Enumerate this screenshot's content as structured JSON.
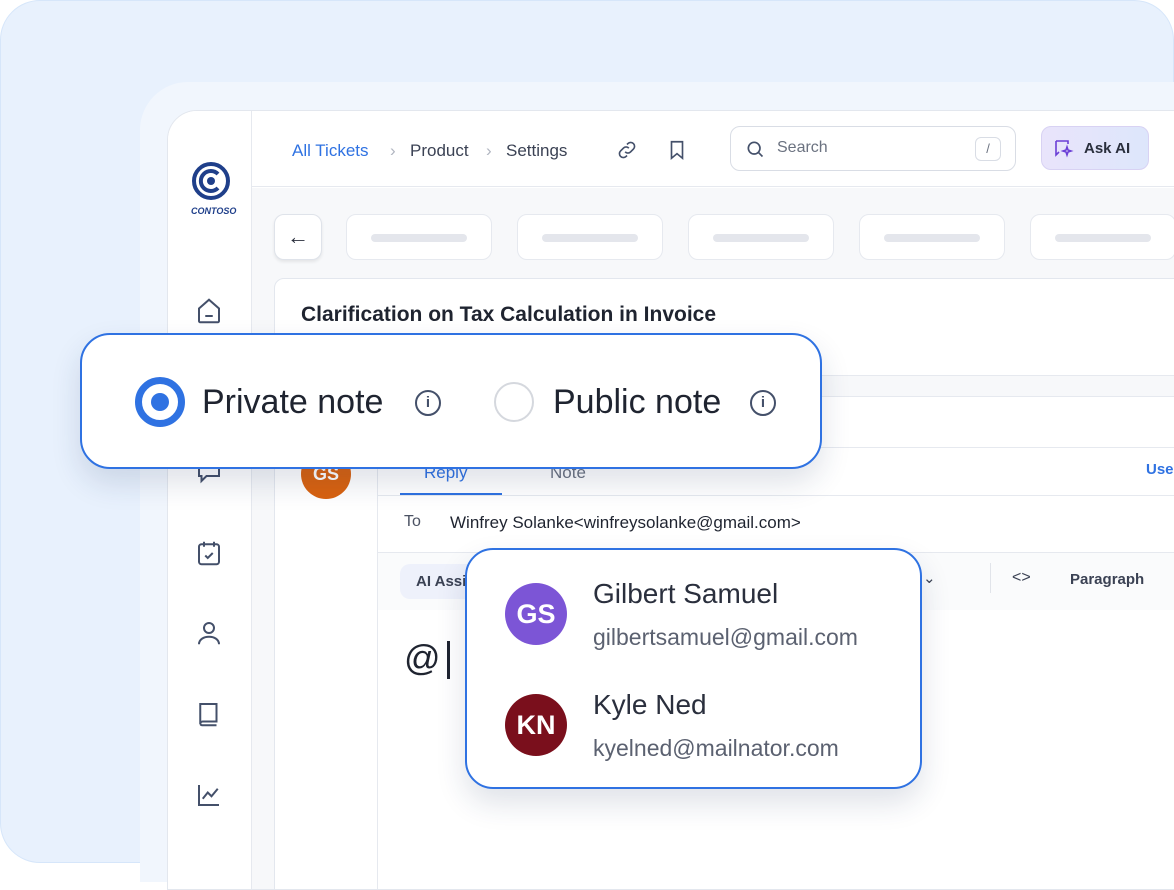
{
  "logo": {
    "text": "CONTOSO"
  },
  "breadcrumb": {
    "items": [
      "All Tickets",
      "Product",
      "Settings"
    ]
  },
  "search": {
    "placeholder": "Search",
    "shortcut": "/"
  },
  "ask_ai": {
    "label": "Ask AI"
  },
  "ticket": {
    "title": "Clarification on Tax Calculation in Invoice",
    "avatar_initials": "GS",
    "avatar_color": "#d9620f"
  },
  "compose": {
    "tabs": [
      "Reply",
      "Note"
    ],
    "active_tab": "Reply",
    "right_link": "Use",
    "to_label": "To",
    "to_value": "Winfrey Solanke<winfreysolanke@gmail.com>",
    "ai_assist": "AI Assist",
    "paragraph": "Paragraph",
    "editor_text": "@"
  },
  "note_type": {
    "options": [
      {
        "label": "Private note",
        "selected": true
      },
      {
        "label": "Public note",
        "selected": false
      }
    ]
  },
  "mentions": [
    {
      "name": "Gilbert Samuel",
      "email": "gilbertsamuel@gmail.com",
      "initials": "GS",
      "color": "#7c55d6"
    },
    {
      "name": "Kyle Ned",
      "email": "kyelned@mailnator.com",
      "initials": "KN",
      "color": "#7a0f1c"
    }
  ],
  "colors": {
    "accent": "#2f72e2",
    "background": "#e8f1fd"
  }
}
